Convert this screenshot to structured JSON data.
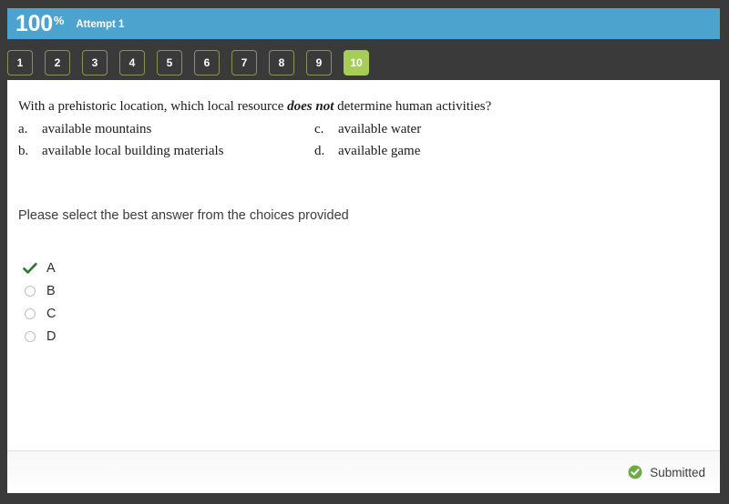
{
  "header": {
    "score": "100",
    "percent_symbol": "%",
    "attempt": "Attempt 1",
    "bar_color": "#4ba3ce"
  },
  "pager": {
    "active_color": "#a5cd58",
    "border_color": "#8e9156",
    "current": "10",
    "buttons": [
      {
        "label": "1",
        "active": false
      },
      {
        "label": "2",
        "active": false
      },
      {
        "label": "3",
        "active": false
      },
      {
        "label": "4",
        "active": false
      },
      {
        "label": "5",
        "active": false
      },
      {
        "label": "6",
        "active": false
      },
      {
        "label": "7",
        "active": false
      },
      {
        "label": "8",
        "active": false
      },
      {
        "label": "9",
        "active": false
      },
      {
        "label": "10",
        "active": true
      }
    ]
  },
  "question": {
    "stem_part1": "With a prehistoric location, which local resource ",
    "stem_emphasis": "does not",
    "stem_part2": " determine human activities?",
    "choices": [
      {
        "letter": "a.",
        "text": "available mountains"
      },
      {
        "letter": "c.",
        "text": "available water"
      },
      {
        "letter": "b.",
        "text": "available local building materials"
      },
      {
        "letter": "d.",
        "text": "available game"
      }
    ]
  },
  "prompt": "Please select the best answer from the choices provided",
  "answers": {
    "selected": "A",
    "check_color": "#2a7a2a",
    "options": [
      {
        "label": "A",
        "selected": true
      },
      {
        "label": "B",
        "selected": false
      },
      {
        "label": "C",
        "selected": false
      },
      {
        "label": "D",
        "selected": false
      }
    ]
  },
  "footer": {
    "status": "Submitted",
    "status_color": "#6cab47"
  }
}
